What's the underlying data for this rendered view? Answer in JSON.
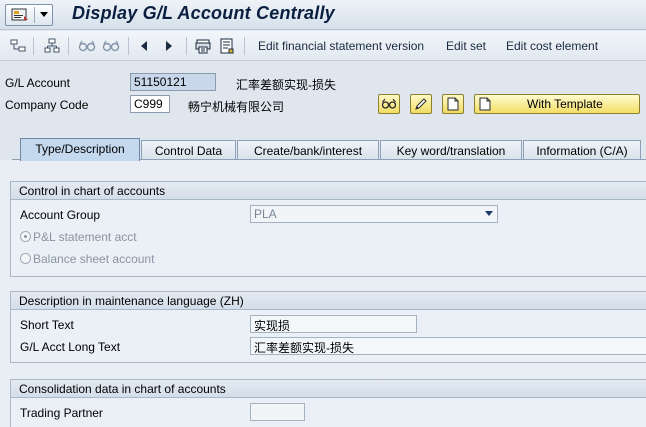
{
  "title": "Display G/L Account Centrally",
  "toolbar": {
    "icons": [
      "hierarchy-icon",
      "tree-icon",
      "glasses-back-icon",
      "glasses-forward-icon",
      "prev-arrow-icon",
      "next-arrow-icon",
      "printer-icon",
      "notes-icon"
    ],
    "edit_fs_version": "Edit financial statement version",
    "edit_set": "Edit set",
    "edit_cost_element": "Edit cost element"
  },
  "header": {
    "gl_account_label": "G/L Account",
    "gl_account_value": "51150121",
    "gl_account_desc": "汇率差额实现-损失",
    "company_code_label": "Company Code",
    "company_code_value": "C999",
    "company_code_desc": "畅宁机械有限公司",
    "with_template_label": "With Template"
  },
  "tabs": [
    {
      "label": "Type/Description",
      "active": true
    },
    {
      "label": "Control Data",
      "active": false
    },
    {
      "label": "Create/bank/interest",
      "active": false
    },
    {
      "label": "Key word/translation",
      "active": false
    },
    {
      "label": "Information (C/A)",
      "active": false
    }
  ],
  "control_group": {
    "title": "Control in chart of accounts",
    "account_group_label": "Account Group",
    "account_group_value": "PLA",
    "pl_statement_label": "P&L statement acct",
    "pl_statement_selected": true,
    "balance_sheet_label": "Balance sheet account",
    "balance_sheet_selected": false
  },
  "description_group": {
    "title": "Description in maintenance language (ZH)",
    "short_text_label": "Short Text",
    "short_text_value": "实现损",
    "long_text_label": "G/L Acct Long Text",
    "long_text_value": "汇率差额实现-损失"
  },
  "consolidation_group": {
    "title": "Consolidation data in chart of accounts",
    "trading_partner_label": "Trading Partner",
    "trading_partner_value": ""
  },
  "colors": {
    "accent_yellow": "#f3df66",
    "tab_active": "#c4d8ee",
    "background": "#dfe6ee"
  }
}
